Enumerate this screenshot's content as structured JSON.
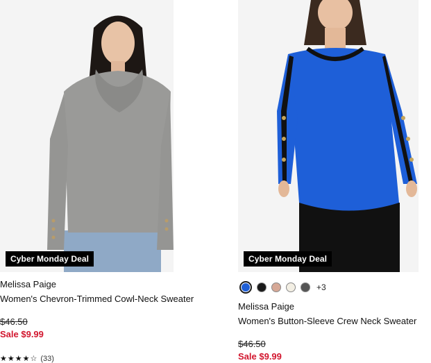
{
  "products": [
    {
      "badge": "Cyber Monday Deal",
      "brand": "Melissa Paige",
      "title": "Women's Chevron-Trimmed Cowl-Neck Sweater",
      "original_price": "$46.50",
      "sale_price": "Sale $9.99",
      "rating": {
        "stars": "★★★★☆",
        "value": 4,
        "count": "(33)"
      },
      "image": {
        "kind": "model-photo",
        "garment_color": "#9a9a98",
        "pants_color": "#8fa9c6"
      }
    },
    {
      "badge": "Cyber Monday Deal",
      "brand": "Melissa Paige",
      "title": "Women's Button-Sleeve Crew Neck Sweater",
      "original_price": "$46.50",
      "sale_price": "Sale $9.99",
      "swatches": [
        {
          "color": "#1f5fd6",
          "selected": true
        },
        {
          "color": "#1a1a1a",
          "selected": false
        },
        {
          "color": "#d6a896",
          "selected": false
        },
        {
          "color": "#f3efe4",
          "selected": false
        },
        {
          "color": "#555555",
          "selected": false
        }
      ],
      "more_colors": "+3",
      "image": {
        "kind": "model-photo",
        "garment_color": "#1e5fd8",
        "pants_color": "#111111"
      }
    }
  ],
  "colors": {
    "sale": "#d2162e",
    "badge_bg": "#000000"
  }
}
